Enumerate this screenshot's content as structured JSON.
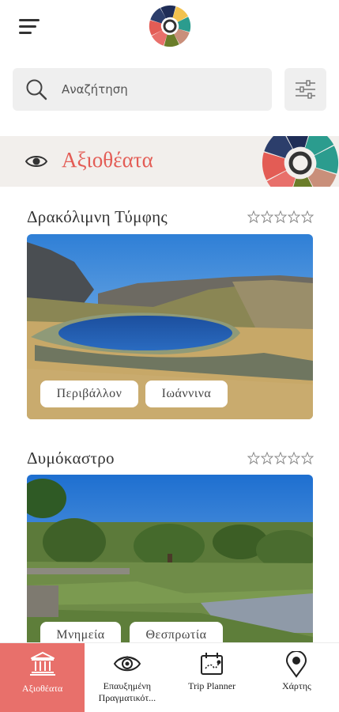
{
  "search": {
    "placeholder": "Αναζήτηση"
  },
  "section": {
    "title": "Αξιοθέατα"
  },
  "cards": [
    {
      "title": "Δρακόλιμνη Τύμφης",
      "rating": 0,
      "max_rating": 5,
      "tags": [
        "Περιβάλλον",
        "Ιωάννινα"
      ]
    },
    {
      "title": "Δυμόκαστρο",
      "rating": 0,
      "max_rating": 5,
      "tags": [
        "Μνημεία",
        "Θεσπρωτία"
      ]
    }
  ],
  "nav": {
    "items": [
      {
        "label": "Αξιοθέατα",
        "icon": "temple-icon",
        "active": true
      },
      {
        "label": "Επαυξημένη Πραγματικότ...",
        "icon": "ar-eye-icon",
        "active": false
      },
      {
        "label": "Trip Planner",
        "icon": "trip-map-icon",
        "active": false
      },
      {
        "label": "Χάρτης",
        "icon": "map-pin-icon",
        "active": false
      }
    ]
  },
  "colors": {
    "accent": "#e8706b",
    "title_red": "#e35c55",
    "header_bg": "#f2efec",
    "search_bg": "#efefef"
  }
}
